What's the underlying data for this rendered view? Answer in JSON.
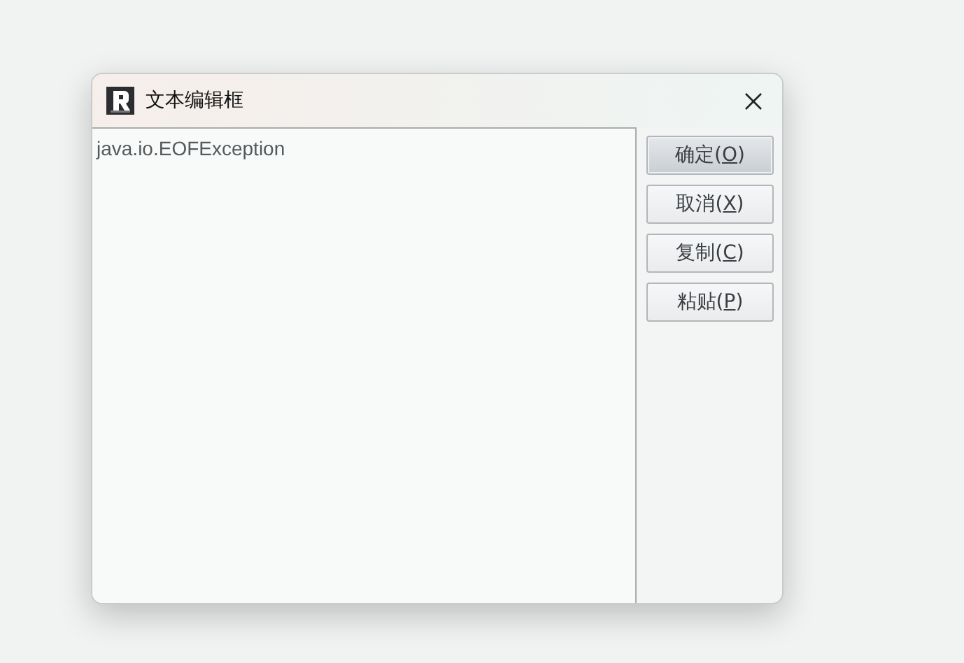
{
  "window": {
    "title": "文本编辑框"
  },
  "editor": {
    "value": "java.io.EOFException"
  },
  "buttons": [
    {
      "prefix": "确定(",
      "key": "O",
      "suffix": ")",
      "default": true
    },
    {
      "prefix": "取消(",
      "key": "X",
      "suffix": ")",
      "default": false
    },
    {
      "prefix": "复制(",
      "key": "C",
      "suffix": ")",
      "default": false
    },
    {
      "prefix": "粘贴(",
      "key": "P",
      "suffix": ")",
      "default": false
    }
  ]
}
